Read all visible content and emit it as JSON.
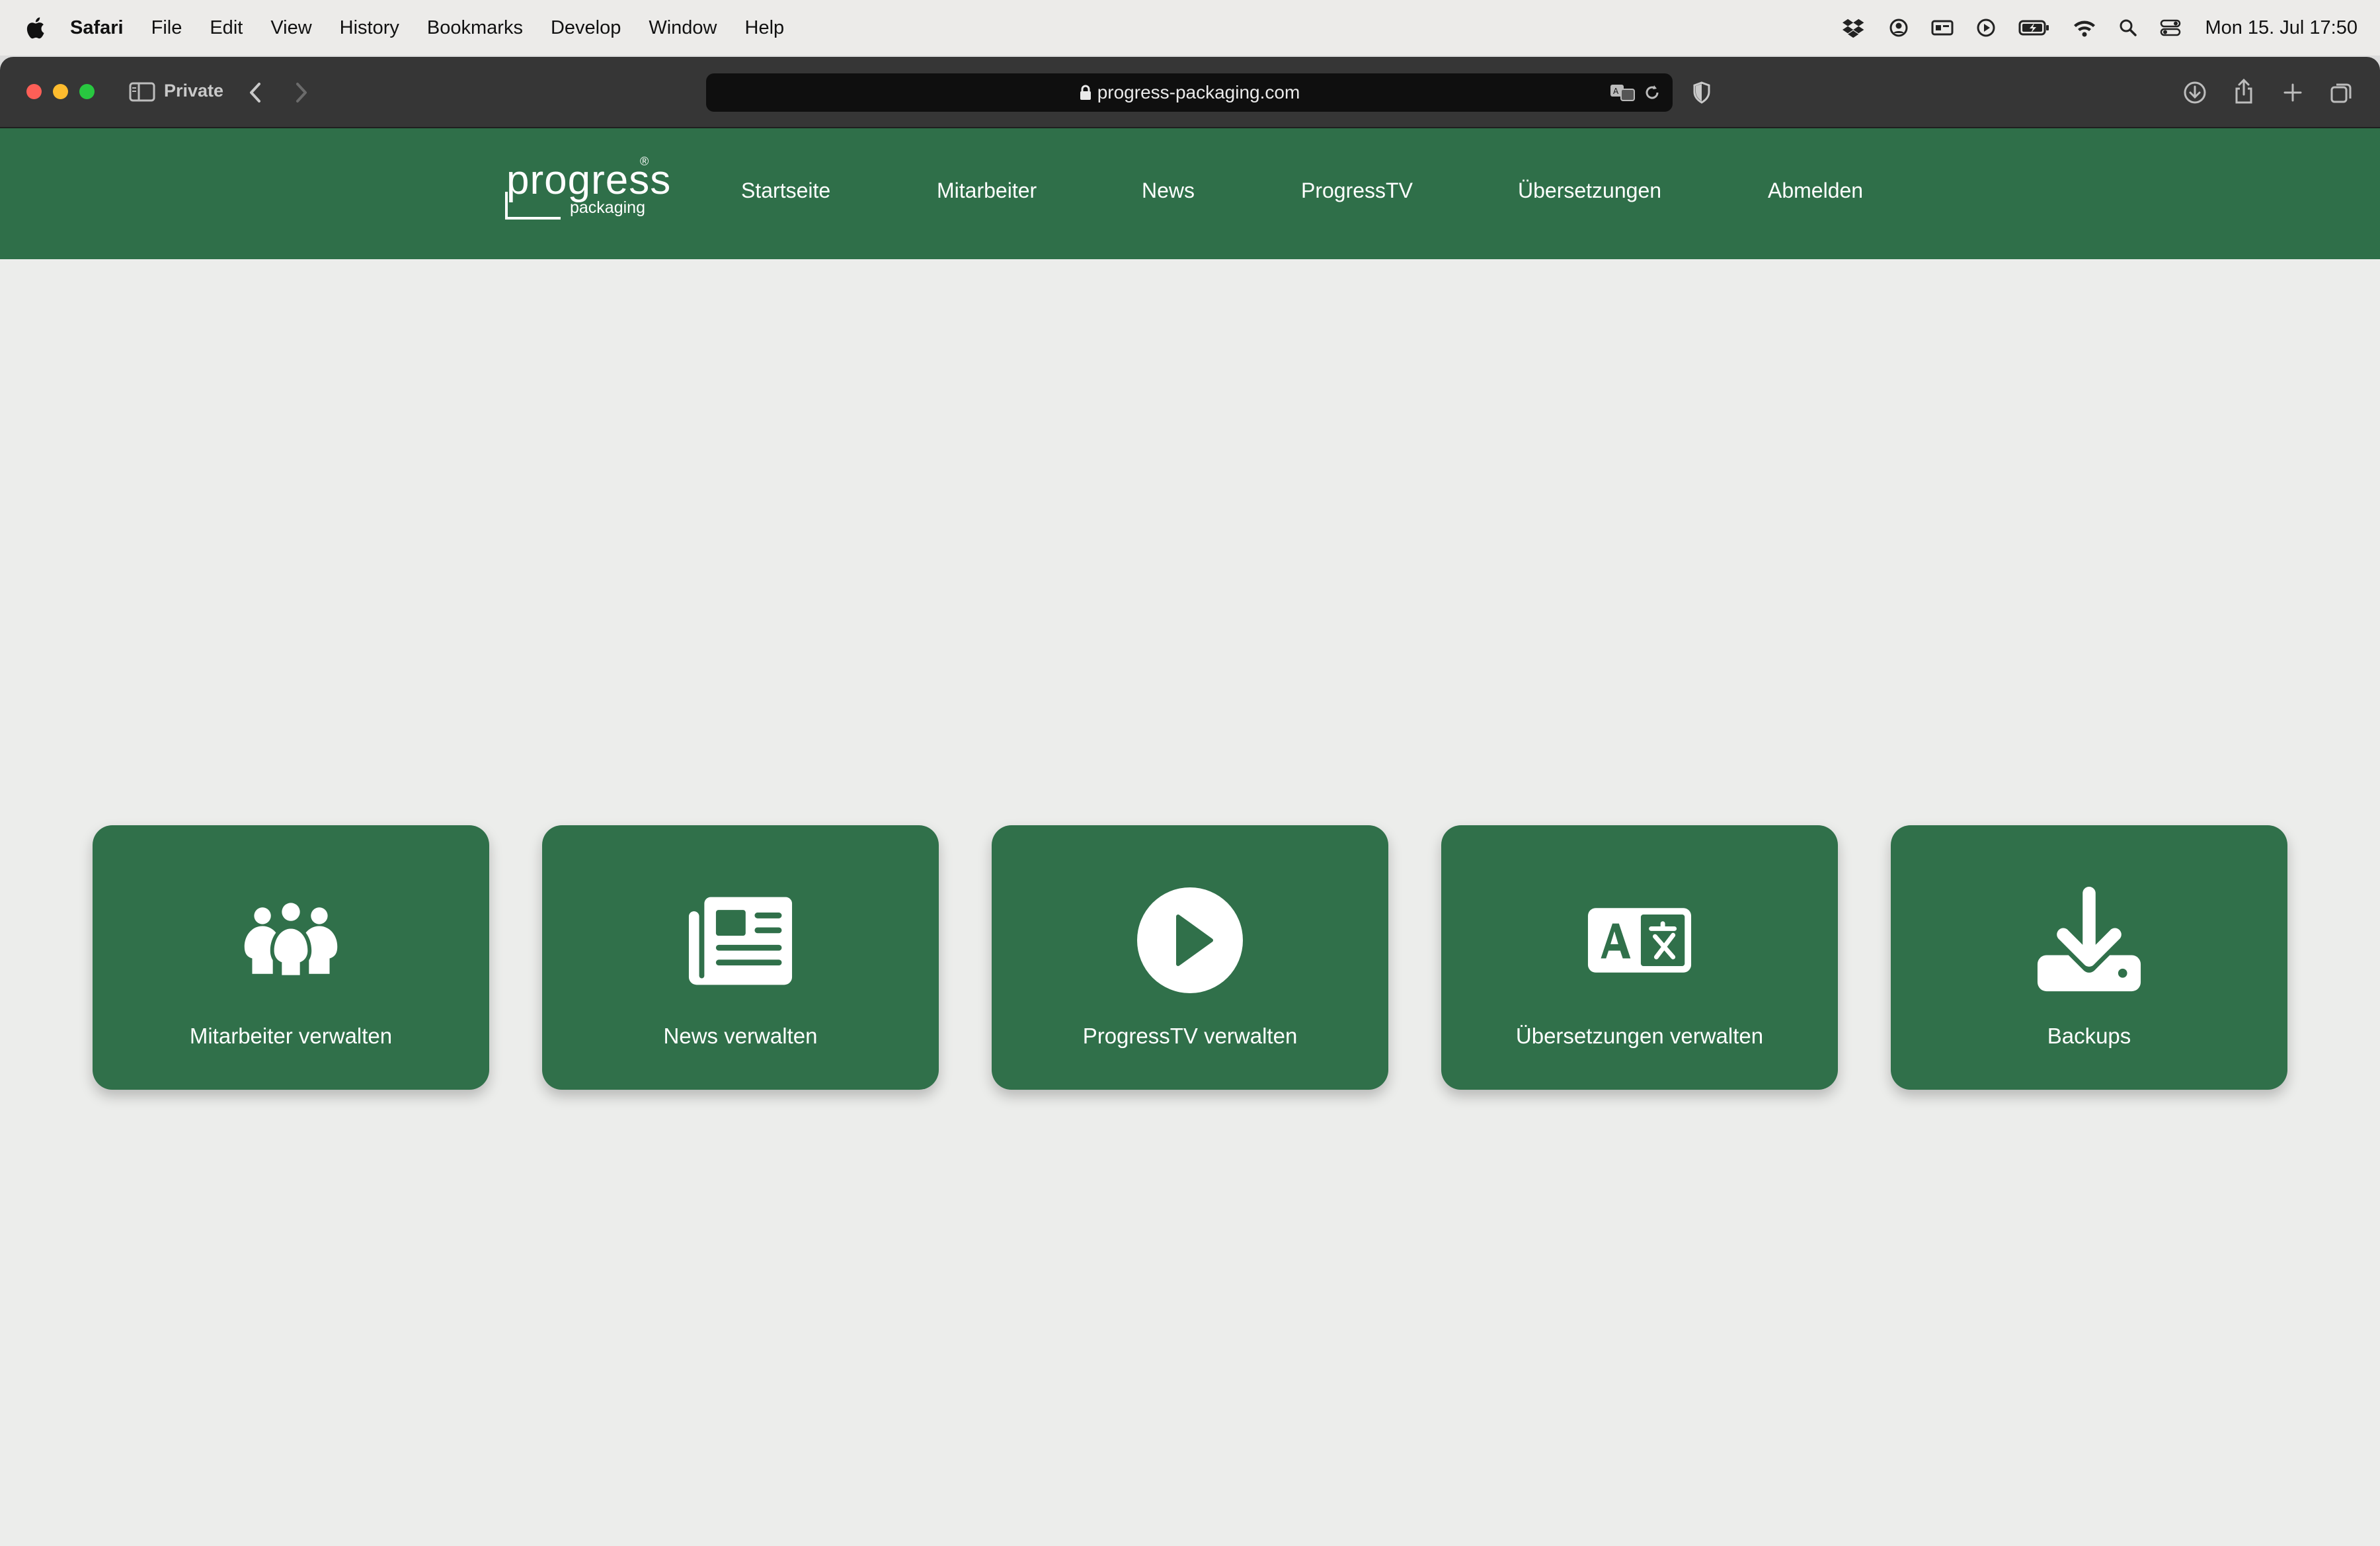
{
  "menubar": {
    "app_name": "Safari",
    "items": [
      "File",
      "Edit",
      "View",
      "History",
      "Bookmarks",
      "Develop",
      "Window",
      "Help"
    ],
    "clock": "Mon 15. Jul  17:50"
  },
  "browser": {
    "private_label": "Private",
    "url": "progress-packaging.com"
  },
  "site": {
    "logo": {
      "word": "progress",
      "sub": "packaging",
      "reg": "®"
    },
    "nav": [
      "Startseite",
      "Mitarbeiter",
      "News",
      "ProgressTV",
      "Übersetzungen",
      "Abmelden"
    ]
  },
  "cards": [
    {
      "label": "Mitarbeiter verwalten",
      "icon": "users-icon"
    },
    {
      "label": "News verwalten",
      "icon": "newspaper-icon"
    },
    {
      "label": "ProgressTV verwalten",
      "icon": "play-icon"
    },
    {
      "label": "Übersetzungen verwalten",
      "icon": "translate-icon"
    },
    {
      "label": "Backups",
      "icon": "download-icon"
    }
  ],
  "colors": {
    "brand_green": "#2f6f49",
    "card_green": "#30704a",
    "page_background": "#ecedeb"
  }
}
